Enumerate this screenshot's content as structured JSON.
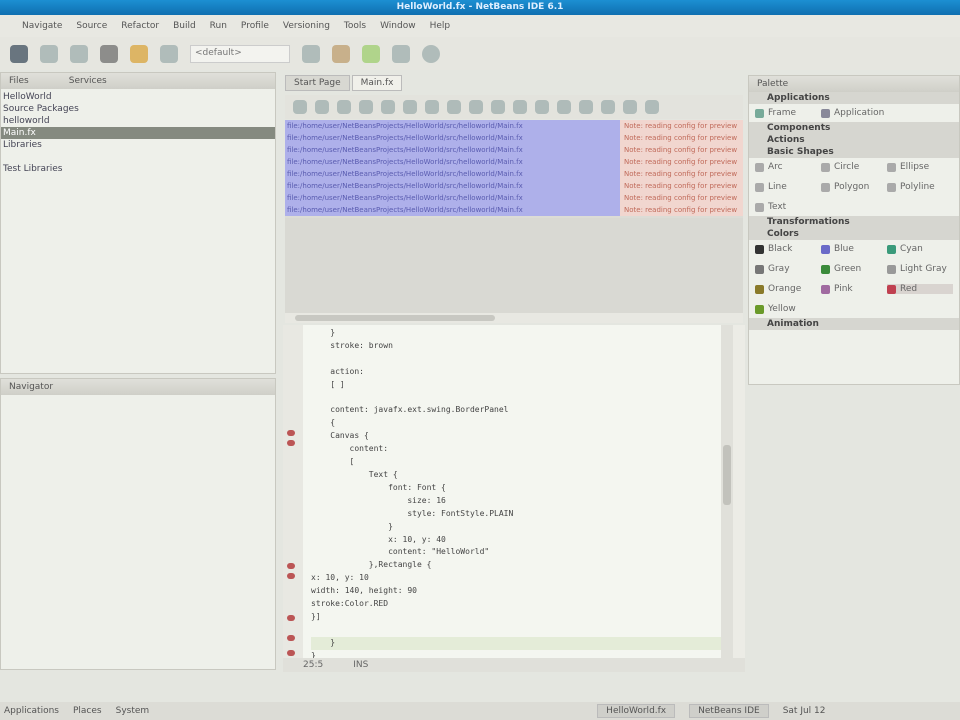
{
  "window": {
    "title": "HelloWorld.fx - NetBeans IDE 6.1"
  },
  "menu": [
    "Navigate",
    "Source",
    "Refactor",
    "Build",
    "Run",
    "Profile",
    "Versioning",
    "Tools",
    "Window",
    "Help"
  ],
  "toolbar": {
    "config": "<default>"
  },
  "left_panel": {
    "tabs": [
      "Files",
      "Services"
    ],
    "tree": [
      "HelloWorld",
      "Source Packages",
      "helloworld",
      "Main.fx",
      "Libraries",
      "",
      "Test Libraries"
    ],
    "selected_index": 3
  },
  "navigator": {
    "title": "Navigator"
  },
  "editor": {
    "tabs": [
      "Start Page",
      "Main.fx"
    ],
    "output": [
      "file:/home/user/NetBeansProjects/HelloWorld/src/helloworld/Main.fx",
      "file:/home/user/NetBeansProjects/HelloWorld/src/helloworld/Main.fx",
      "file:/home/user/NetBeansProjects/HelloWorld/src/helloworld/Main.fx",
      "file:/home/user/NetBeansProjects/HelloWorld/src/helloworld/Main.fx",
      "file:/home/user/NetBeansProjects/HelloWorld/src/helloworld/Main.fx",
      "file:/home/user/NetBeansProjects/HelloWorld/src/helloworld/Main.fx",
      "file:/home/user/NetBeansProjects/HelloWorld/src/helloworld/Main.fx",
      "file:/home/user/NetBeansProjects/HelloWorld/src/helloworld/Main.fx"
    ],
    "output_note": "Note: reading config for preview",
    "code": [
      "    }",
      "    stroke: brown",
      "",
      "    action:",
      "    [ ]",
      "",
      "    content: javafx.ext.swing.BorderPanel",
      "    {",
      "    Canvas {",
      "        content:",
      "        [",
      "            Text {",
      "                font: Font {",
      "                    size: 16",
      "                    style: FontStyle.PLAIN",
      "                }",
      "                x: 10, y: 40",
      "                content: \"HelloWorld\"",
      "            },Rectangle {",
      "x: 10, y: 10",
      "width: 140, height: 90",
      "stroke:Color.RED",
      "}]",
      "",
      "    }",
      "}"
    ],
    "current_line": 24,
    "status": {
      "position": "25:5",
      "mode": "INS"
    }
  },
  "palette": {
    "title": "Palette",
    "sections": [
      {
        "name": "Applications",
        "items": [
          {
            "label": "Frame",
            "color": "#7a9"
          },
          {
            "label": "Application",
            "color": "#889"
          }
        ]
      },
      {
        "name": "Components",
        "items": []
      },
      {
        "name": "Actions",
        "items": []
      },
      {
        "name": "Basic Shapes",
        "items": [
          {
            "label": "Arc",
            "color": "#aaa"
          },
          {
            "label": "Circle",
            "color": "#aaa"
          },
          {
            "label": "Ellipse",
            "color": "#aaa"
          },
          {
            "label": "Line",
            "color": "#aaa"
          },
          {
            "label": "Polygon",
            "color": "#aaa"
          },
          {
            "label": "Polyline",
            "color": "#aaa"
          },
          {
            "label": "Text",
            "color": "#aaa"
          }
        ]
      },
      {
        "name": "Transformations",
        "items": []
      },
      {
        "name": "Colors",
        "items": [
          {
            "label": "Black",
            "color": "#333333"
          },
          {
            "label": "Blue",
            "color": "#6a6ac8"
          },
          {
            "label": "Cyan",
            "color": "#3a9a7a"
          },
          {
            "label": "Gray",
            "color": "#777777"
          },
          {
            "label": "Green",
            "color": "#3a8a3a"
          },
          {
            "label": "Light Gray",
            "color": "#999999"
          },
          {
            "label": "Orange",
            "color": "#8a7a2a"
          },
          {
            "label": "Pink",
            "color": "#a06aa0"
          },
          {
            "label": "Red",
            "color": "#c04050"
          },
          {
            "label": "Yellow",
            "color": "#6a9a2a"
          }
        ]
      },
      {
        "name": "Animation",
        "items": []
      }
    ]
  },
  "taskbar": {
    "menus": [
      "Applications",
      "Places",
      "System"
    ],
    "tasks": [
      "HelloWorld.fx",
      "NetBeans IDE"
    ],
    "clock": "Sat Jul 12"
  }
}
